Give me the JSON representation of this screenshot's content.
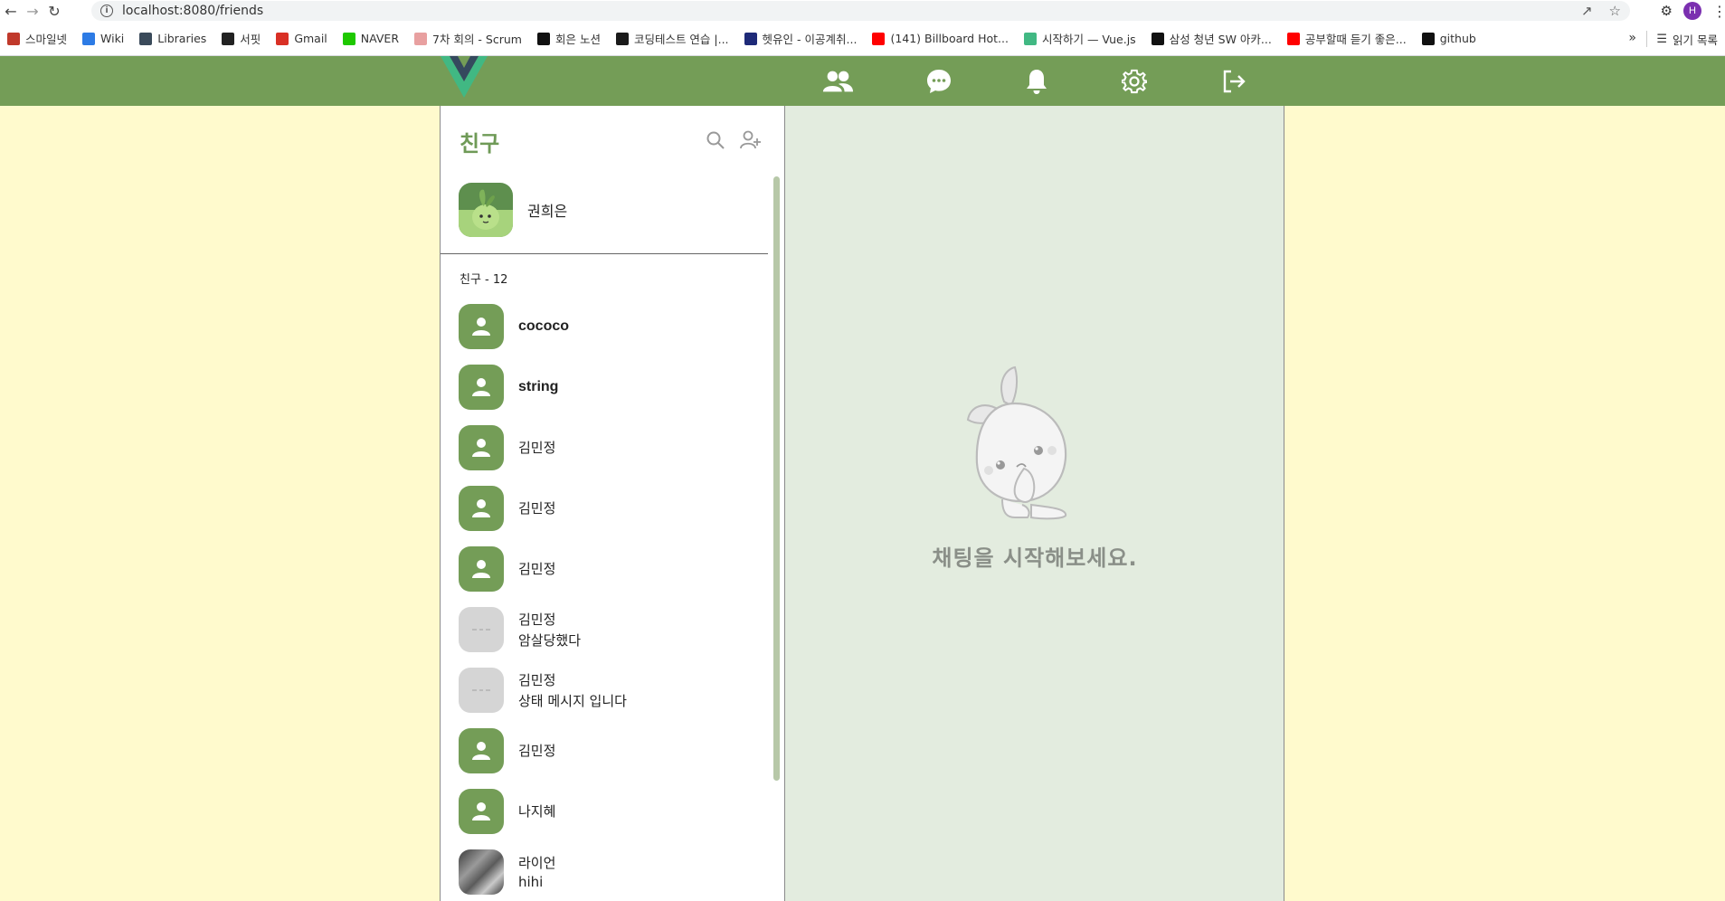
{
  "browser": {
    "url": "localhost:8080/friends",
    "profile_initial": "H",
    "bookmarks": [
      {
        "label": "스마일넷",
        "color": "#c0392b"
      },
      {
        "label": "Wiki",
        "color": "#2d7be5"
      },
      {
        "label": "Libraries",
        "color": "#3a4a5a"
      },
      {
        "label": "서핏",
        "color": "#222222"
      },
      {
        "label": "Gmail",
        "color": "#d93025"
      },
      {
        "label": "NAVER",
        "color": "#1ec800"
      },
      {
        "label": "7차 회의 - Scrum",
        "color": "#e8a0a0"
      },
      {
        "label": "회은 노션",
        "color": "#111111"
      },
      {
        "label": "코딩테스트 연습 |...",
        "color": "#1a1a1a"
      },
      {
        "label": "헷유인 - 이공계취...",
        "color": "#1e2a78"
      },
      {
        "label": "(141) Billboard Hot...",
        "color": "#ff0000"
      },
      {
        "label": "시작하기 — Vue.js",
        "color": "#41b883"
      },
      {
        "label": "삼성 청년 SW 아카...",
        "color": "#111111"
      },
      {
        "label": "공부할때 듣기 좋은...",
        "color": "#ff0000"
      },
      {
        "label": "github",
        "color": "#111111"
      }
    ],
    "more_label": "»",
    "reading_list_label": "읽기 목록"
  },
  "app": {
    "accent_color": "#749d57",
    "background_color": "#fffacd",
    "nav": [
      "friends-icon",
      "chat-icon",
      "bell-icon",
      "gear-icon",
      "logout-icon"
    ]
  },
  "friends": {
    "title": "친구",
    "me": {
      "name": "권희은"
    },
    "count_label": "친구 - 12",
    "list": [
      {
        "name": "cococo",
        "status": "",
        "avatar": "green"
      },
      {
        "name": "string",
        "status": "",
        "avatar": "green"
      },
      {
        "name": "김민정",
        "status": "",
        "avatar": "green"
      },
      {
        "name": "김민정",
        "status": "",
        "avatar": "green"
      },
      {
        "name": "김민정",
        "status": "",
        "avatar": "green"
      },
      {
        "name": "김민정",
        "status": "암살당했다",
        "avatar": "grey"
      },
      {
        "name": "김민정",
        "status": "상태 메시지 입니다",
        "avatar": "grey"
      },
      {
        "name": "김민정",
        "status": "",
        "avatar": "green"
      },
      {
        "name": "나지혜",
        "status": "",
        "avatar": "green"
      },
      {
        "name": "라이언",
        "status": "hihi",
        "avatar": "photo"
      }
    ]
  },
  "chat": {
    "empty_message": "채팅을 시작해보세요."
  }
}
